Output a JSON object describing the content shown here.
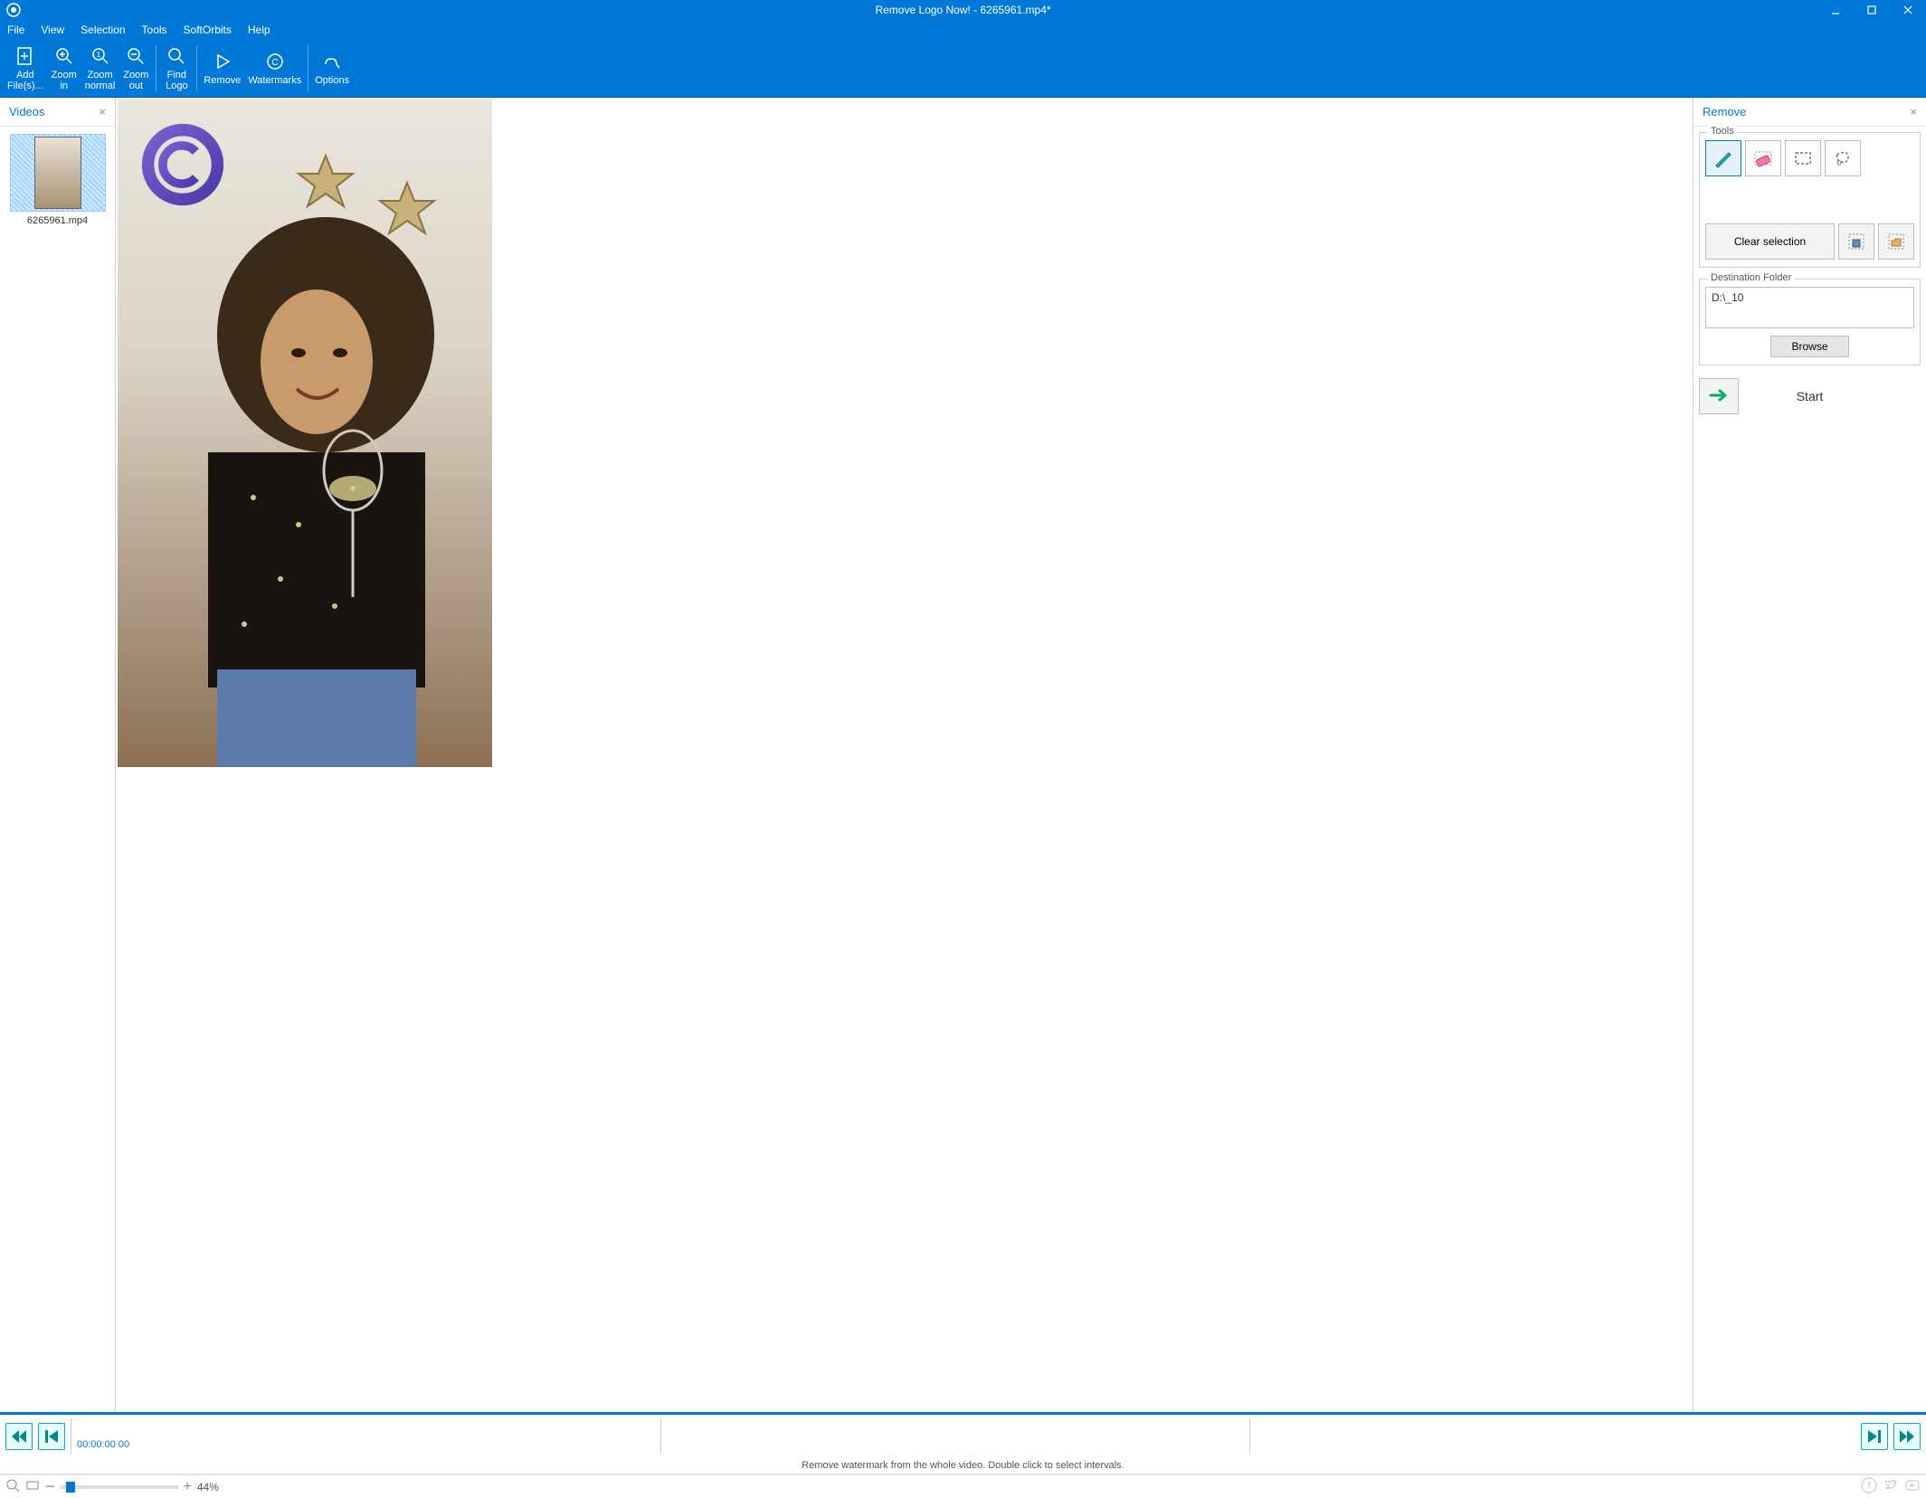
{
  "titlebar": {
    "title": "Remove Logo Now! - 6265961.mp4*"
  },
  "menubar": {
    "file": "File",
    "view": "View",
    "selection": "Selection",
    "tools": "Tools",
    "softorbits": "SoftOrbits",
    "help": "Help"
  },
  "toolbar": {
    "add_files": "Add\nFile(s)...",
    "zoom_in": "Zoom\nin",
    "zoom_normal": "Zoom\nnormal",
    "zoom_out": "Zoom\nout",
    "find_logo": "Find\nLogo",
    "remove": "Remove",
    "watermarks": "Watermarks",
    "options": "Options"
  },
  "left_panel": {
    "title": "Videos",
    "item_label": "6265961.mp4"
  },
  "right_panel": {
    "title": "Remove",
    "tools_label": "Tools",
    "clear_selection": "Clear selection",
    "dest_label": "Destination Folder",
    "dest_path": "D:\\_10",
    "browse": "Browse",
    "start": "Start"
  },
  "timeline": {
    "time": "00:00:00 00",
    "hint": "Remove watermark from the whole video. Double click to select intervals."
  },
  "statusbar": {
    "zoom": "44%"
  }
}
